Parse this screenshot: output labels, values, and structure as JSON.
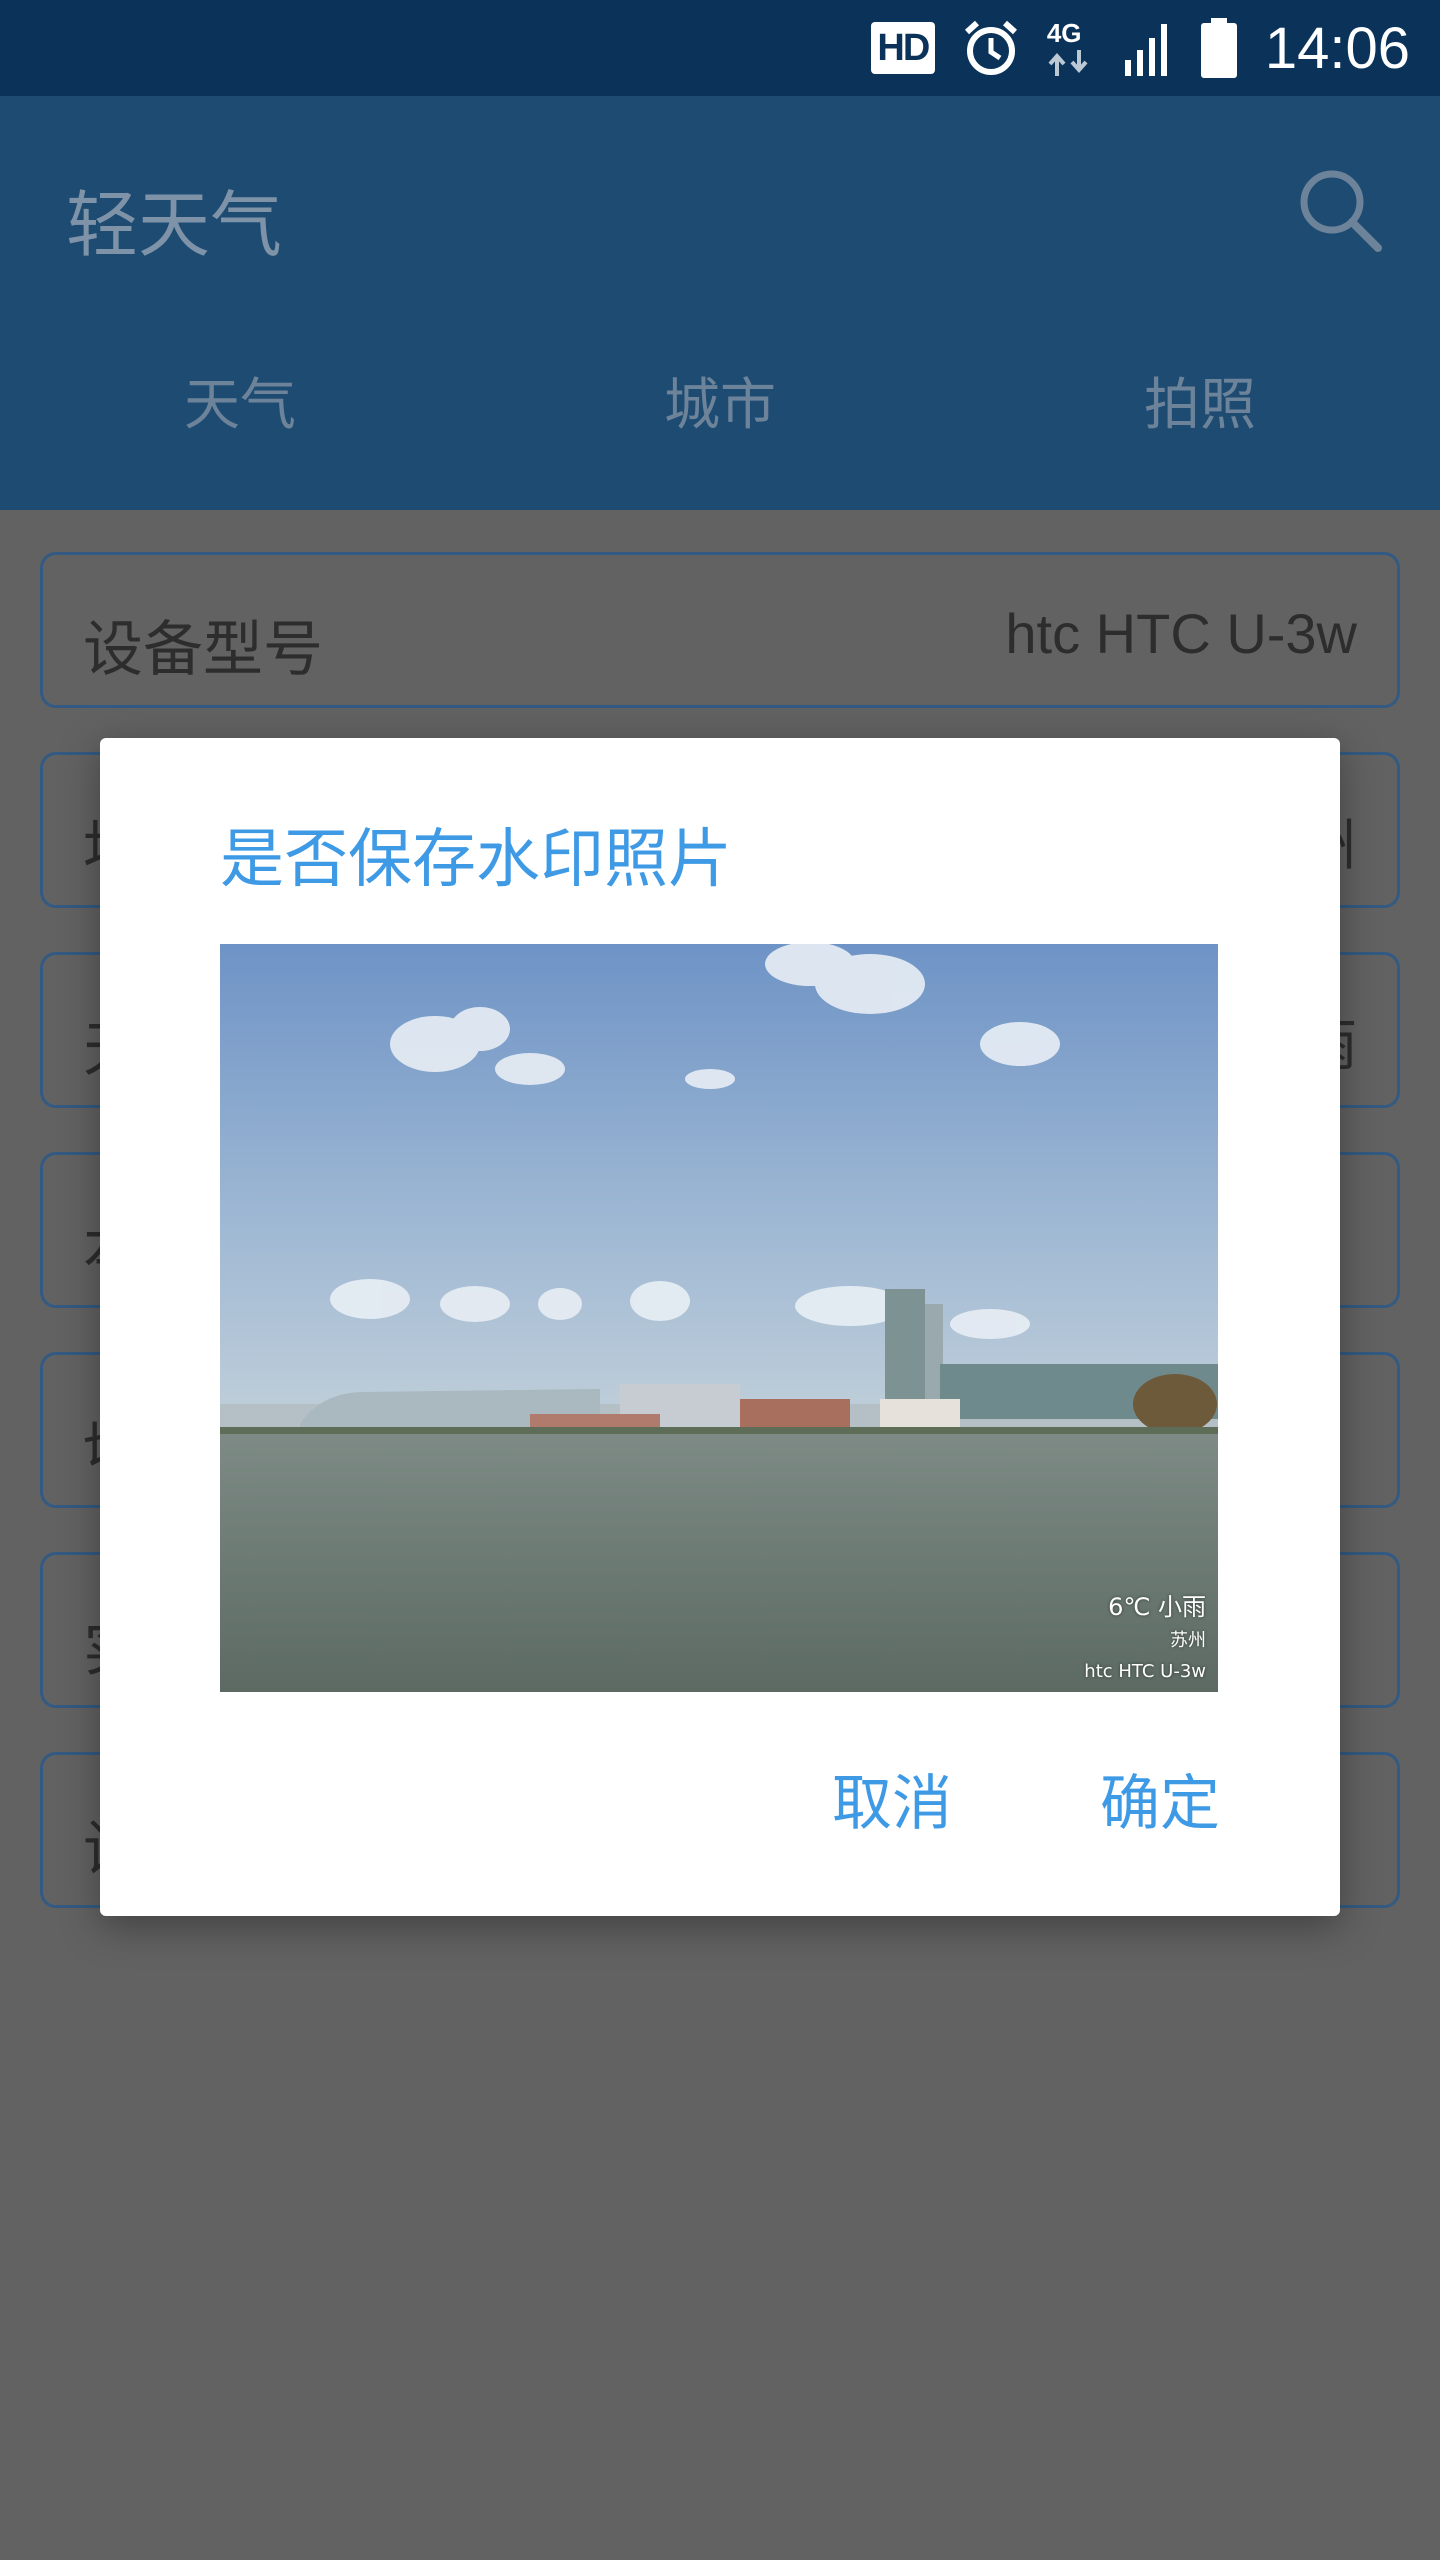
{
  "status_bar": {
    "hd_badge": "HD",
    "network": "4G",
    "time": "14:06"
  },
  "app": {
    "title": "轻天气",
    "tabs": [
      "天气",
      "城市",
      "拍照"
    ]
  },
  "rows": [
    {
      "label": "设备型号",
      "value": "htc HTC U-3w"
    },
    {
      "label": "地",
      "value": "州"
    },
    {
      "label": "天",
      "value": "雨"
    },
    {
      "label": "本",
      "value": ""
    },
    {
      "label": "切",
      "value": ""
    },
    {
      "label": "实",
      "value": ""
    },
    {
      "label": "设",
      "value": ""
    }
  ],
  "dialog": {
    "title": "是否保存水印照片",
    "watermark": {
      "weather": "6℃ 小雨",
      "city": "苏州",
      "device": "htc HTC U-3w"
    },
    "cancel_label": "取消",
    "confirm_label": "确定"
  },
  "colors": {
    "accent": "#3f9ae6",
    "status_bar": "#0b335a",
    "app_bar": "#1e4b72"
  }
}
